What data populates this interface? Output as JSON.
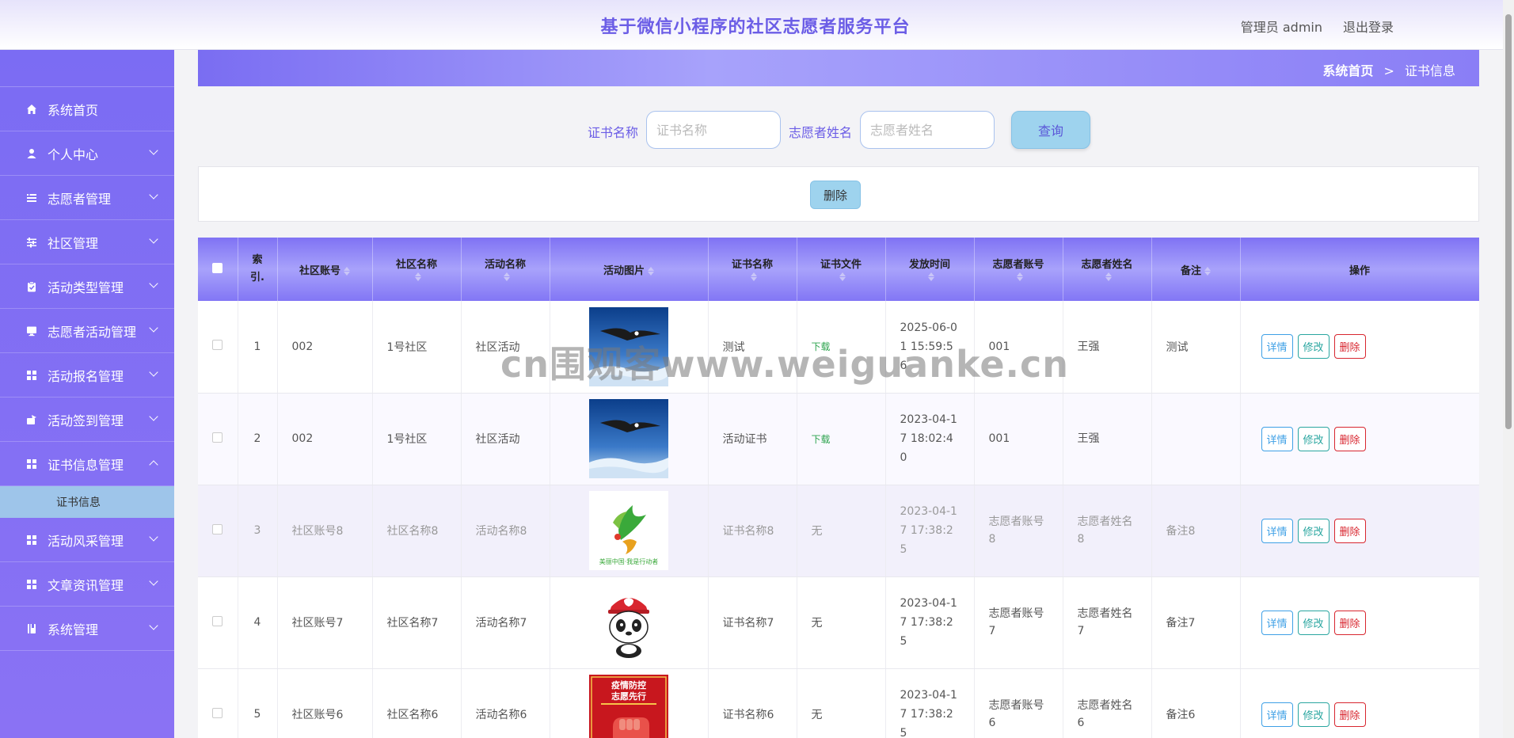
{
  "header": {
    "title": "基于微信小程序的社区志愿者服务平台",
    "user": "管理员 admin",
    "logout": "退出登录"
  },
  "sidebar": {
    "items": [
      {
        "label": "系统首页",
        "icon": "home-icon",
        "has_children": false
      },
      {
        "label": "个人中心",
        "icon": "user-icon",
        "has_children": true
      },
      {
        "label": "志愿者管理",
        "icon": "list-icon",
        "has_children": true
      },
      {
        "label": "社区管理",
        "icon": "sliders-icon",
        "has_children": true
      },
      {
        "label": "活动类型管理",
        "icon": "clipboard-icon",
        "has_children": true
      },
      {
        "label": "志愿者活动管理",
        "icon": "monitor-icon",
        "has_children": true
      },
      {
        "label": "活动报名管理",
        "icon": "grid-icon",
        "has_children": true
      },
      {
        "label": "活动签到管理",
        "icon": "signin-icon",
        "has_children": true
      },
      {
        "label": "证书信息管理",
        "icon": "grid-icon",
        "has_children": true,
        "expanded": true
      },
      {
        "label": "活动风采管理",
        "icon": "grid-icon",
        "has_children": true
      },
      {
        "label": "文章资讯管理",
        "icon": "grid-icon",
        "has_children": true
      },
      {
        "label": "系统管理",
        "icon": "book-icon",
        "has_children": true
      }
    ],
    "submenu_active": "证书信息"
  },
  "breadcrumb": {
    "home": "系统首页",
    "separator": ">",
    "current": "证书信息"
  },
  "search": {
    "cert_label": "证书名称",
    "cert_placeholder": "证书名称",
    "name_label": "志愿者姓名",
    "name_placeholder": "志愿者姓名",
    "query_button": "查询"
  },
  "actions": {
    "delete_button": "删除"
  },
  "table": {
    "headers": {
      "index": "索引.",
      "community_account": "社区账号",
      "community_name": "社区名称",
      "activity_name": "活动名称",
      "activity_image": "活动图片",
      "cert_name": "证书名称",
      "cert_file": "证书文件",
      "issue_time": "发放时间",
      "volunteer_account": "志愿者账号",
      "volunteer_name": "志愿者姓名",
      "remark": "备注",
      "operation": "操作"
    },
    "rows": [
      {
        "index": "1",
        "community_account": "002",
        "community_name": "1号社区",
        "activity_name": "社区活动",
        "image": "eagle",
        "cert_name": "测试",
        "cert_file": "下载",
        "issue_time": "2025-06-01 15:59:56",
        "volunteer_account": "001",
        "volunteer_name": "王强",
        "remark": "测试"
      },
      {
        "index": "2",
        "community_account": "002",
        "community_name": "1号社区",
        "activity_name": "社区活动",
        "image": "eagle",
        "cert_name": "活动证书",
        "cert_file": "下载",
        "issue_time": "2023-04-17 18:02:40",
        "volunteer_account": "001",
        "volunteer_name": "王强",
        "remark": ""
      },
      {
        "index": "3",
        "community_account": "社区账号8",
        "community_name": "社区名称8",
        "activity_name": "活动名称8",
        "image": "logo",
        "cert_name": "证书名称8",
        "cert_file": "无",
        "issue_time": "2023-04-17 17:38:25",
        "volunteer_account": "志愿者账号8",
        "volunteer_name": "志愿者姓名8",
        "remark": "备注8"
      },
      {
        "index": "4",
        "community_account": "社区账号7",
        "community_name": "社区名称7",
        "activity_name": "活动名称7",
        "image": "panda",
        "cert_name": "证书名称7",
        "cert_file": "无",
        "issue_time": "2023-04-17 17:38:25",
        "volunteer_account": "志愿者账号7",
        "volunteer_name": "志愿者姓名7",
        "remark": "备注7"
      },
      {
        "index": "5",
        "community_account": "社区账号6",
        "community_name": "社区名称6",
        "activity_name": "活动名称6",
        "image": "poster",
        "cert_name": "证书名称6",
        "cert_file": "无",
        "issue_time": "2023-04-17 17:38:25",
        "volunteer_account": "志愿者账号6",
        "volunteer_name": "志愿者姓名6",
        "remark": "备注6"
      }
    ],
    "row_buttons": {
      "detail": "详情",
      "edit": "修改",
      "delete": "删除"
    }
  },
  "images": {
    "logo_caption": "美丽中国·我是行动者",
    "poster_line1": "疫情防控",
    "poster_line2": "志愿先行"
  },
  "watermark": "cn围观客www.weiguanke.cn",
  "colors": {
    "accent": "#6b5de6",
    "sidebar": "#7b6cf3",
    "download": "#2ea44f",
    "danger": "#d8262f"
  }
}
